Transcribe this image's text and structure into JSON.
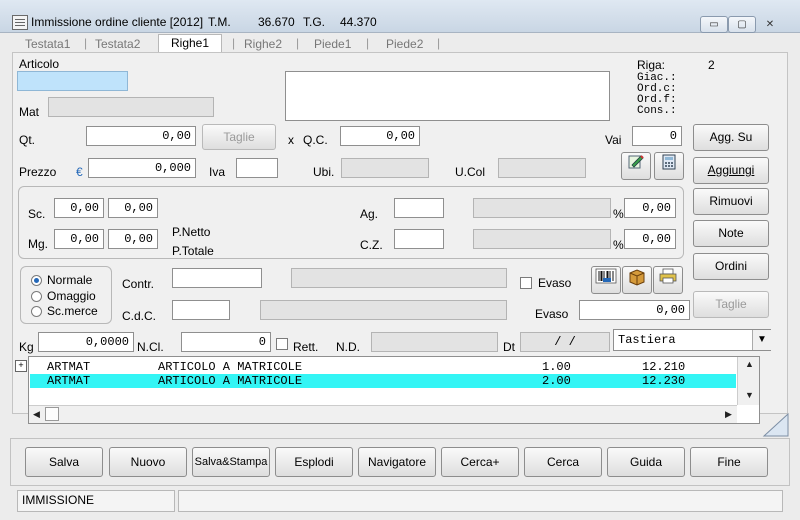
{
  "window": {
    "title": "Immissione ordine cliente [2012]",
    "tm_label": "T.M.",
    "tm_value": "36.670",
    "tg_label": "T.G.",
    "tg_value": "44.370",
    "buttons": {
      "minimize": "▭",
      "maximize": "▢",
      "close": "✕"
    }
  },
  "tabs": [
    {
      "label": "Testata1"
    },
    {
      "label": "Testata2"
    },
    {
      "label": "Righe1",
      "active": true
    },
    {
      "label": "Righe2"
    },
    {
      "label": "Piede1"
    },
    {
      "label": "Piede2"
    }
  ],
  "form": {
    "articolo_label": "Articolo",
    "articolo_value": "",
    "riga_label": "Riga:",
    "riga_value": "2",
    "giac_label": "Giac.:",
    "ordc_label": "Ord.c:",
    "ordf_label": "Ord.f:",
    "cons_label": "Cons.:",
    "mat_label": "Mat",
    "qt_label": "Qt.",
    "qt_value": "0,00",
    "taglie_label": "Taglie",
    "qc_x": "x",
    "qc_label": "Q.C.",
    "qc_value": "0,00",
    "vai_label": "Vai",
    "vai_value": "0",
    "prezzo_label": "Prezzo",
    "euro": "€",
    "prezzo_value": "0,000",
    "iva_label": "Iva",
    "ubi_label": "Ubi.",
    "ucol_label": "U.Col",
    "sc_label": "Sc.",
    "sc1": "0,00",
    "sc2": "0,00",
    "mg_label": "Mg.",
    "mg1": "0,00",
    "mg2": "0,00",
    "pnetto_label": "P.Netto",
    "ptotale_label": "P.Totale",
    "ag_label": "Ag.",
    "ag_pct": "0,00",
    "cz_label": "C.Z.",
    "cz_pct": "0,00",
    "pct": "%",
    "radio_normale": "Normale",
    "radio_omaggio": "Omaggio",
    "radio_scmerce": "Sc.merce",
    "contr_label": "Contr.",
    "cdc_label": "C.d.C.",
    "evaso_chk_label": "Evaso",
    "evaso_label": "Evaso",
    "evaso_value": "0,00",
    "kg_label": "Kg",
    "kg_value": "0,0000",
    "ncl_label": "N.Cl.",
    "ncl_value": "0",
    "rett_label": "Rett.",
    "nd_label": "N.D.",
    "dt_label": "Dt",
    "dt_value": "/  /",
    "tastiera_value": "Tastiera"
  },
  "side_buttons": {
    "agg_su": "Agg. Su",
    "aggiungi": "Aggiungi",
    "rimuovi": "Rimuovi",
    "note": "Note",
    "ordini": "Ordini",
    "taglie": "Taglie"
  },
  "grid": {
    "expand": "+",
    "rows": [
      {
        "code": "ARTMAT",
        "desc": "ARTICOLO A MATRICOLE",
        "qty": "1.00",
        "price": "12.210",
        "selected": false
      },
      {
        "code": "ARTMAT",
        "desc": "ARTICOLO A MATRICOLE",
        "qty": "2.00",
        "price": "12.230",
        "selected": true
      }
    ]
  },
  "toolbar": {
    "salva": "Salva",
    "nuovo": "Nuovo",
    "salva_stampa": "Salva&Stampa",
    "esplodi": "Esplodi",
    "navigatore": "Navigatore",
    "cerca_plus": "Cerca+",
    "cerca": "Cerca",
    "guida": "Guida",
    "fine": "Fine"
  },
  "status": {
    "mode": "IMMISSIONE",
    "info": ""
  },
  "colors": {
    "selected_row": "#33f5f5",
    "articolo_field": "#bfe3fb",
    "link_blue": "#2468b8"
  }
}
